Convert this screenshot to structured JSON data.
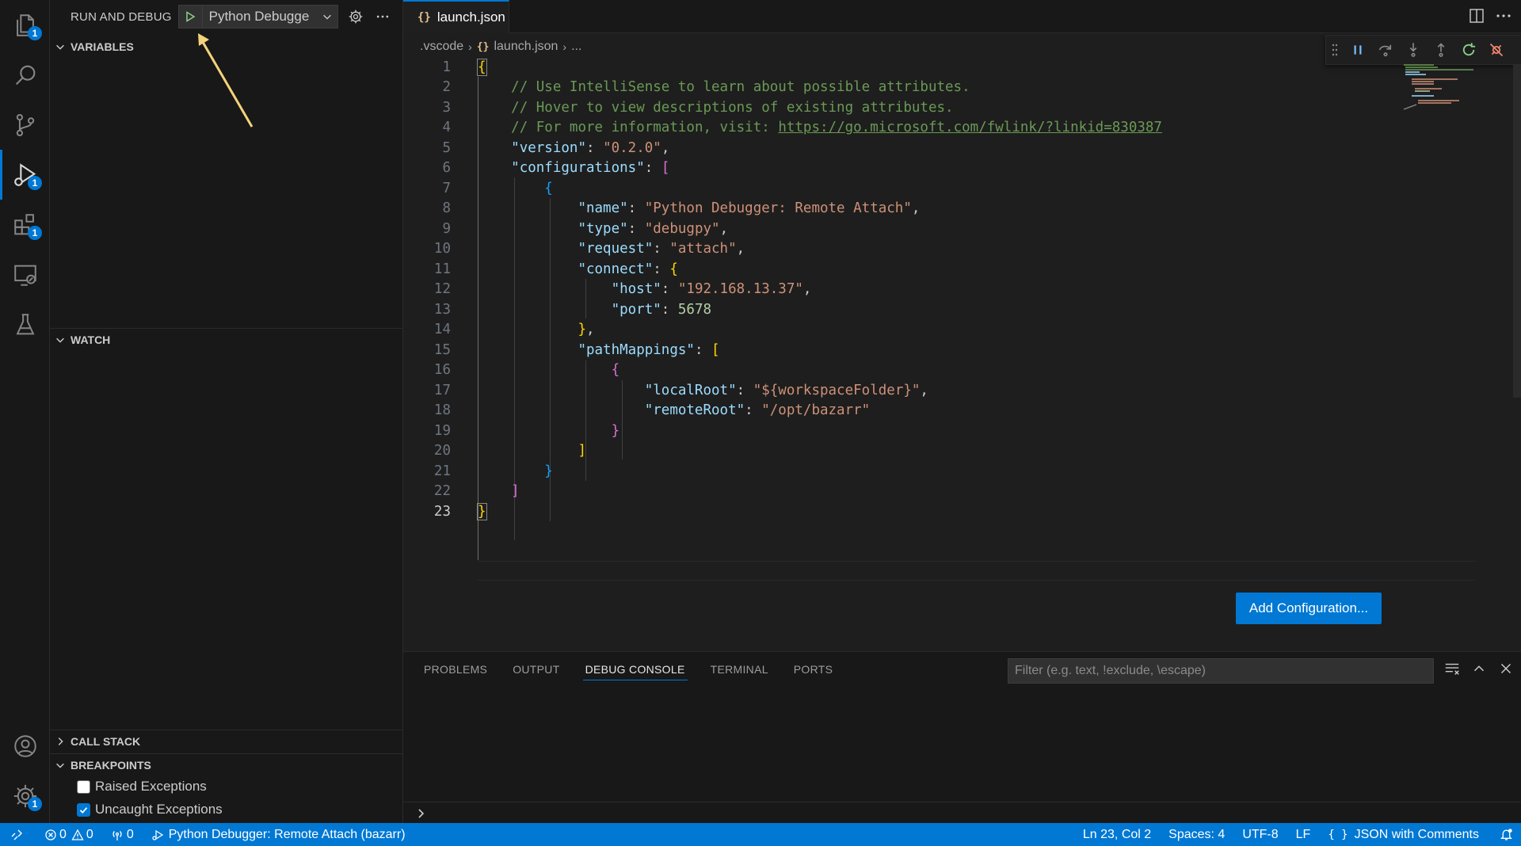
{
  "activity_bar": {
    "items": [
      {
        "name": "explorer",
        "icon": "files-icon",
        "badge": "1"
      },
      {
        "name": "search",
        "icon": "search-icon",
        "badge": ""
      },
      {
        "name": "source-control",
        "icon": "source-control-icon",
        "badge": ""
      },
      {
        "name": "run-and-debug",
        "icon": "debug-icon",
        "badge": "1"
      },
      {
        "name": "extensions",
        "icon": "extensions-icon",
        "badge": "1"
      },
      {
        "name": "remote-explorer",
        "icon": "remote-explorer-icon",
        "badge": ""
      },
      {
        "name": "testing",
        "icon": "beaker-icon",
        "badge": ""
      }
    ],
    "accounts_icon": "account-icon",
    "manage_icon": "gear-icon",
    "manage_badge": "1"
  },
  "sidebar": {
    "title": "RUN AND DEBUG",
    "launch_config": "Python Debugge",
    "sections": {
      "variables": "VARIABLES",
      "watch": "WATCH",
      "call_stack": "CALL STACK",
      "breakpoints": "BREAKPOINTS"
    },
    "breakpoints": [
      {
        "label": "Raised Exceptions",
        "checked": false
      },
      {
        "label": "Uncaught Exceptions",
        "checked": true
      }
    ]
  },
  "editor": {
    "tab": {
      "icon_text": "{}",
      "label": "launch.json",
      "modified": true
    },
    "breadcrumb": {
      "folder": ".vscode",
      "icon_text": "{}",
      "file": "launch.json",
      "more": "..."
    },
    "current_line": "23",
    "line_numbers": [
      "1",
      "2",
      "3",
      "4",
      "5",
      "6",
      "7",
      "8",
      "9",
      "10",
      "11",
      "12",
      "13",
      "14",
      "15",
      "16",
      "17",
      "18",
      "19",
      "20",
      "21",
      "22",
      "23"
    ],
    "code": {
      "comment1": "// Use IntelliSense to learn about possible attributes.",
      "comment2": "// Hover to view descriptions of existing attributes.",
      "comment3_prefix": "// For more information, visit: ",
      "comment3_link": "https://go.microsoft.com/fwlink/?linkid=830387",
      "version_key": "\"version\"",
      "version_val": "\"0.2.0\"",
      "configurations_key": "\"configurations\"",
      "name_key": "\"name\"",
      "name_val": "\"Python Debugger: Remote Attach\"",
      "type_key": "\"type\"",
      "type_val": "\"debugpy\"",
      "request_key": "\"request\"",
      "request_val": "\"attach\"",
      "connect_key": "\"connect\"",
      "host_key": "\"host\"",
      "host_val": "\"192.168.13.37\"",
      "port_key": "\"port\"",
      "port_val": "5678",
      "pathmappings_key": "\"pathMappings\"",
      "localroot_key": "\"localRoot\"",
      "localroot_val": "\"${workspaceFolder}\"",
      "remoteroot_key": "\"remoteRoot\"",
      "remoteroot_val": "\"/opt/bazarr\""
    },
    "add_configuration": "Add Configuration..."
  },
  "panel": {
    "tabs": [
      "PROBLEMS",
      "OUTPUT",
      "DEBUG CONSOLE",
      "TERMINAL",
      "PORTS"
    ],
    "active_tab": "DEBUG CONSOLE",
    "filter_placeholder": "Filter (e.g. text, !exclude, \\escape)"
  },
  "status_bar": {
    "errors": "0",
    "warnings": "0",
    "ports": "0",
    "debug_session": "Python Debugger: Remote Attach (bazarr)",
    "position": "Ln 23, Col 2",
    "spaces": "Spaces: 4",
    "encoding": "UTF-8",
    "eol": "LF",
    "language_icon_text": "{ }",
    "language": "JSON with Comments"
  },
  "colors": {
    "accent": "#0078d4",
    "annotation_arrow": "#f5d37a",
    "play_green": "#89d185"
  }
}
